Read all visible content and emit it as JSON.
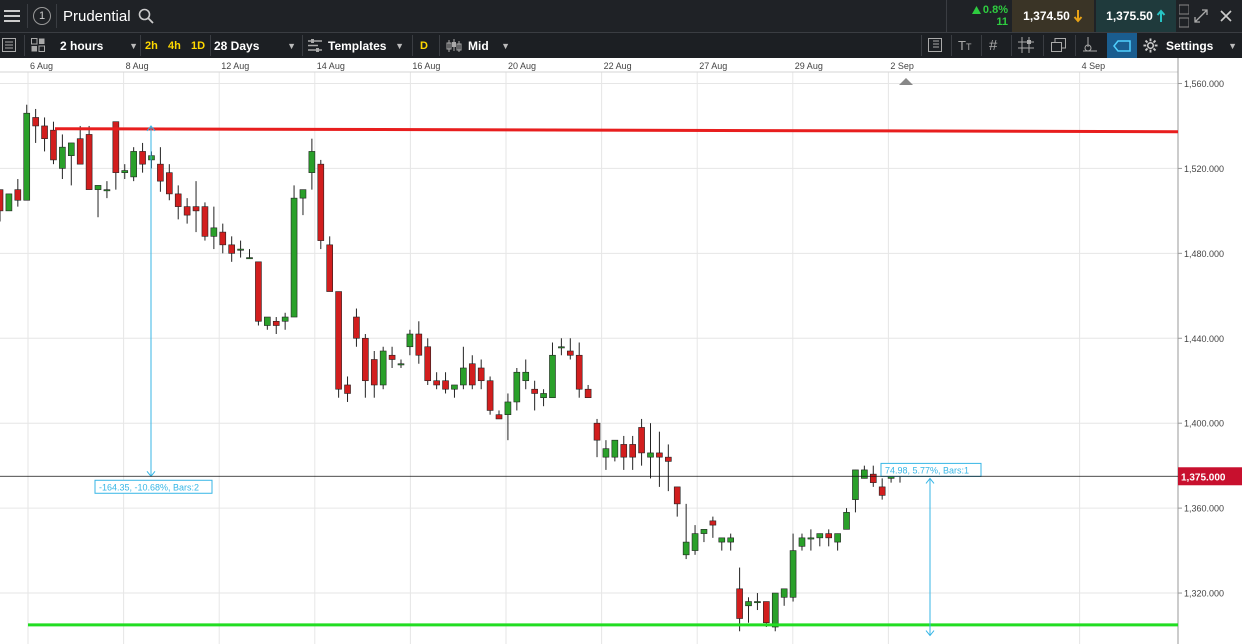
{
  "topbar": {
    "instrument": "Prudential",
    "info_glyph": "1",
    "change_pct": "0.8%",
    "change_count": "11",
    "sell_price": "1,374.50",
    "buy_price": "1,375.50"
  },
  "toolbar": {
    "interval": "2 hours",
    "quick_intervals": [
      "2h",
      "4h",
      "1D"
    ],
    "range": "28 Days",
    "templates": "Templates",
    "d_button": "D",
    "price_type": "Mid",
    "settings": "Settings"
  },
  "chart_data": {
    "type": "candlestick",
    "x_labels": [
      "6 Aug",
      "8 Aug",
      "12 Aug",
      "14 Aug",
      "16 Aug",
      "20 Aug",
      "22 Aug",
      "27 Aug",
      "29 Aug",
      "2 Sep",
      "4 Sep"
    ],
    "y_ticks": [
      "1,560.000",
      "1,520.000",
      "1,480.000",
      "1,440.000",
      "1,400.000",
      "1,360.000",
      "1,320.000"
    ],
    "current_price": "1,375.000",
    "ylim": [
      1296,
      1572
    ],
    "grid": true,
    "candles": [
      [
        1510,
        1510,
        1495,
        1500
      ],
      [
        1500,
        1508,
        1502,
        1508
      ],
      [
        1510,
        1515,
        1502,
        1505
      ],
      [
        1505,
        1550,
        1505,
        1546
      ],
      [
        1544,
        1548,
        1532,
        1540
      ],
      [
        1540,
        1544,
        1528,
        1534
      ],
      [
        1538,
        1542,
        1522,
        1524
      ],
      [
        1520,
        1536,
        1515,
        1530
      ],
      [
        1526,
        1532,
        1512,
        1532
      ],
      [
        1534,
        1540,
        1522,
        1522
      ],
      [
        1536,
        1540,
        1512,
        1510
      ],
      [
        1510,
        1512,
        1497,
        1512
      ],
      [
        1510,
        1514,
        1506,
        1510
      ],
      [
        1542,
        1542,
        1510,
        1518
      ],
      [
        1518,
        1522,
        1515,
        1519
      ],
      [
        1516,
        1530,
        1514,
        1528
      ],
      [
        1528,
        1532,
        1518,
        1522
      ],
      [
        1524,
        1528,
        1520,
        1526
      ],
      [
        1522,
        1530,
        1509,
        1514
      ],
      [
        1518,
        1522,
        1505,
        1508
      ],
      [
        1508,
        1512,
        1496,
        1502
      ],
      [
        1502,
        1506,
        1494,
        1498
      ],
      [
        1502,
        1514,
        1490,
        1500
      ],
      [
        1502,
        1504,
        1486,
        1488
      ],
      [
        1488,
        1502,
        1482,
        1492
      ],
      [
        1490,
        1494,
        1480,
        1484
      ],
      [
        1484,
        1488,
        1476,
        1480
      ],
      [
        1482,
        1486,
        1478,
        1482
      ],
      [
        1478,
        1482,
        1478,
        1478
      ],
      [
        1476,
        1476,
        1446,
        1448
      ],
      [
        1446,
        1450,
        1444,
        1450
      ],
      [
        1448,
        1450,
        1442,
        1446
      ],
      [
        1448,
        1452,
        1444,
        1450
      ],
      [
        1450,
        1512,
        1450,
        1506
      ],
      [
        1506,
        1510,
        1498,
        1510
      ],
      [
        1518,
        1534,
        1510,
        1528
      ],
      [
        1522,
        1524,
        1482,
        1486
      ],
      [
        1484,
        1488,
        1462,
        1462
      ],
      [
        1462,
        1462,
        1412,
        1416
      ],
      [
        1418,
        1422,
        1410,
        1414
      ],
      [
        1450,
        1454,
        1436,
        1440
      ],
      [
        1440,
        1442,
        1412,
        1420
      ],
      [
        1430,
        1434,
        1412,
        1418
      ],
      [
        1418,
        1436,
        1416,
        1434
      ],
      [
        1432,
        1436,
        1426,
        1430
      ],
      [
        1428,
        1430,
        1426,
        1428
      ],
      [
        1436,
        1444,
        1432,
        1442
      ],
      [
        1442,
        1448,
        1428,
        1432
      ],
      [
        1436,
        1440,
        1418,
        1420
      ],
      [
        1420,
        1424,
        1416,
        1418
      ],
      [
        1420,
        1424,
        1414,
        1416
      ],
      [
        1416,
        1418,
        1412,
        1418
      ],
      [
        1418,
        1436,
        1416,
        1426
      ],
      [
        1428,
        1432,
        1416,
        1418
      ],
      [
        1426,
        1430,
        1416,
        1420
      ],
      [
        1420,
        1422,
        1404,
        1406
      ],
      [
        1404,
        1406,
        1402,
        1402
      ],
      [
        1404,
        1414,
        1392,
        1410
      ],
      [
        1410,
        1426,
        1406,
        1424
      ],
      [
        1420,
        1430,
        1416,
        1424
      ],
      [
        1416,
        1420,
        1406,
        1414
      ],
      [
        1412,
        1416,
        1408,
        1414
      ],
      [
        1412,
        1438,
        1412,
        1432
      ],
      [
        1436,
        1440,
        1432,
        1436
      ],
      [
        1434,
        1440,
        1430,
        1432
      ],
      [
        1432,
        1438,
        1412,
        1416
      ],
      [
        1416,
        1418,
        1414,
        1412
      ],
      [
        1400,
        1402,
        1384,
        1392
      ],
      [
        1384,
        1392,
        1378,
        1388
      ],
      [
        1384,
        1392,
        1382,
        1392
      ],
      [
        1390,
        1394,
        1378,
        1384
      ],
      [
        1390,
        1394,
        1378,
        1384
      ],
      [
        1398,
        1402,
        1380,
        1386
      ],
      [
        1384,
        1400,
        1374,
        1386
      ],
      [
        1386,
        1396,
        1370,
        1384
      ],
      [
        1384,
        1390,
        1368,
        1382
      ],
      [
        1370,
        1370,
        1356,
        1362
      ],
      [
        1338,
        1362,
        1336,
        1344
      ],
      [
        1340,
        1352,
        1338,
        1348
      ],
      [
        1348,
        1350,
        1344,
        1350
      ],
      [
        1354,
        1356,
        1346,
        1352
      ],
      [
        1344,
        1346,
        1340,
        1346
      ],
      [
        1344,
        1348,
        1340,
        1346
      ],
      [
        1322,
        1332,
        1302,
        1308
      ],
      [
        1314,
        1318,
        1306,
        1316
      ],
      [
        1316,
        1320,
        1312,
        1316
      ],
      [
        1316,
        1316,
        1304,
        1306
      ],
      [
        1304,
        1320,
        1302,
        1320
      ],
      [
        1318,
        1322,
        1314,
        1322
      ],
      [
        1318,
        1348,
        1316,
        1340
      ],
      [
        1342,
        1348,
        1340,
        1346
      ],
      [
        1346,
        1350,
        1340,
        1346
      ],
      [
        1346,
        1348,
        1342,
        1348
      ],
      [
        1348,
        1350,
        1342,
        1346
      ],
      [
        1344,
        1348,
        1340,
        1348
      ],
      [
        1350,
        1360,
        1350,
        1358
      ],
      [
        1364,
        1378,
        1358,
        1378
      ],
      [
        1374,
        1380,
        1374,
        1378
      ],
      [
        1376,
        1380,
        1370,
        1372
      ],
      [
        1370,
        1374,
        1364,
        1366
      ],
      [
        1374,
        1378,
        1372,
        1376
      ],
      [
        1376,
        1378,
        1372,
        1376
      ]
    ],
    "resistance_level": 1538,
    "support_level": 1305,
    "annotations": [
      {
        "text": "-164.35, -10.68%, Bars:2",
        "from": 1540,
        "to": 1375
      },
      {
        "text": "74.98, 5.77%, Bars:1",
        "from": 1374,
        "to": 1300
      }
    ]
  }
}
